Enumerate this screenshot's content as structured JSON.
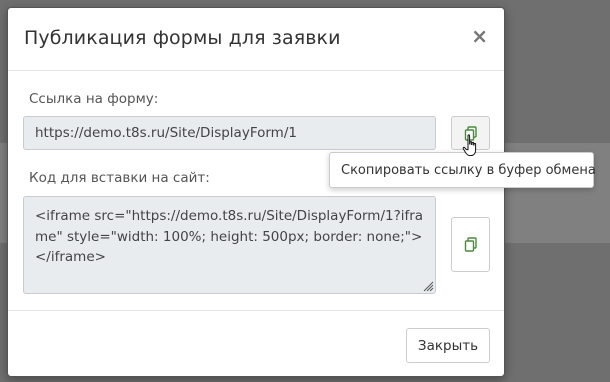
{
  "modal": {
    "title": "Публикация формы для заявки",
    "close_symbol": "×"
  },
  "link": {
    "label": "Ссылка на форму:",
    "value": "https://demo.t8s.ru/Site/DisplayForm/1",
    "copy_icon": "copy-icon"
  },
  "embed": {
    "label": "Код для вставки на сайт:",
    "value": "<iframe src=\"https://demo.t8s.ru/Site/DisplayForm/1?iframe\" style=\"width: 100%; height: 500px; border: none;\"></iframe>",
    "copy_icon": "copy-icon"
  },
  "tooltip": {
    "text": "Скопировать ссылку в буфер обмена"
  },
  "footer": {
    "close_label": "Закрыть"
  },
  "colors": {
    "icon_green": "#4a8a3a",
    "field_bg": "#e9ecef",
    "overlay": "#6f6f6f"
  }
}
